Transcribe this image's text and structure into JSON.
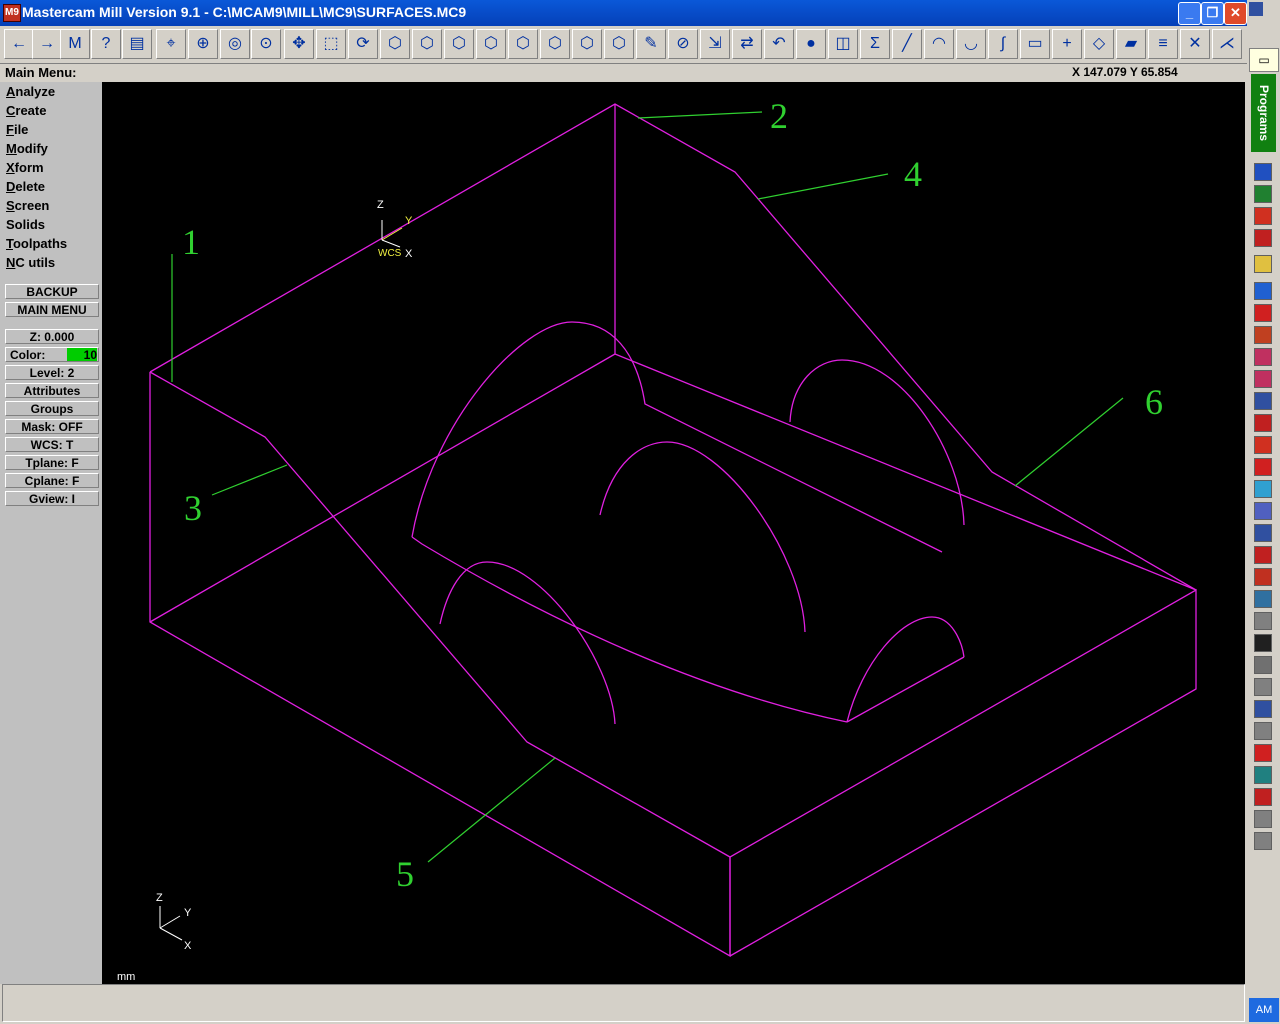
{
  "window": {
    "title": "Mastercam Mill Version 9.1 - C:\\MCAM9\\MILL\\MC9\\SURFACES.MC9",
    "app_icon": "M9"
  },
  "title_buttons": {
    "minimize": "_",
    "restore": "❐",
    "close": "✕"
  },
  "toolbar": [
    {
      "name": "back-icon",
      "glyph": "←"
    },
    {
      "name": "forward-icon",
      "glyph": "→"
    },
    {
      "name": "mcu-icon",
      "glyph": "M"
    },
    {
      "name": "help-icon",
      "glyph": "?"
    },
    {
      "name": "calculator-icon",
      "glyph": "▤"
    },
    {
      "name": "analyze-icon",
      "glyph": "⌖"
    },
    {
      "name": "zoom-window-icon",
      "glyph": "⊕"
    },
    {
      "name": "zoom-fit-icon",
      "glyph": "◎"
    },
    {
      "name": "zoom-unzoom-icon",
      "glyph": "⊙"
    },
    {
      "name": "pan-icon",
      "glyph": "✥"
    },
    {
      "name": "select-zoom-icon",
      "glyph": "⬚"
    },
    {
      "name": "rotate-icon",
      "glyph": "⟳"
    },
    {
      "name": "view-iso-icon",
      "glyph": "⬡"
    },
    {
      "name": "view-top-icon",
      "glyph": "⬡"
    },
    {
      "name": "view-front-icon",
      "glyph": "⬡"
    },
    {
      "name": "view-side-icon",
      "glyph": "⬡"
    },
    {
      "name": "cplane-top-icon",
      "glyph": "⬡"
    },
    {
      "name": "cplane-front-icon",
      "glyph": "⬡"
    },
    {
      "name": "cplane-side-icon",
      "glyph": "⬡"
    },
    {
      "name": "cplane-3d-icon",
      "glyph": "⬡"
    },
    {
      "name": "eraser-icon",
      "glyph": "✎"
    },
    {
      "name": "delete-icon",
      "glyph": "⊘"
    },
    {
      "name": "xform-translate-icon",
      "glyph": "⇲"
    },
    {
      "name": "xform-mirror-icon",
      "glyph": "⇄"
    },
    {
      "name": "undo-icon",
      "glyph": "↶"
    },
    {
      "name": "shade-sphere-icon",
      "glyph": "●"
    },
    {
      "name": "surface-icon",
      "glyph": "◫"
    },
    {
      "name": "sum-icon",
      "glyph": "Σ"
    },
    {
      "name": "line-icon",
      "glyph": "╱"
    },
    {
      "name": "arc-icon",
      "glyph": "◠"
    },
    {
      "name": "fillet-icon",
      "glyph": "◡"
    },
    {
      "name": "spline-icon",
      "glyph": "∫"
    },
    {
      "name": "rectangle-icon",
      "glyph": "▭"
    },
    {
      "name": "point-icon",
      "glyph": "+"
    },
    {
      "name": "plane-icon",
      "glyph": "◇"
    },
    {
      "name": "solid-box-icon",
      "glyph": "▰"
    },
    {
      "name": "layers-icon",
      "glyph": "≡"
    },
    {
      "name": "trim-icon",
      "glyph": "✕"
    },
    {
      "name": "trim-2-icon",
      "glyph": "⋌"
    }
  ],
  "main_menu_label": "Main Menu:",
  "coords": "X 147.079  Y 65.854",
  "menu": [
    {
      "key": "A",
      "rest": "nalyze"
    },
    {
      "key": "C",
      "rest": "reate"
    },
    {
      "key": "F",
      "rest": "ile"
    },
    {
      "key": "M",
      "rest": "odify"
    },
    {
      "key": "X",
      "rest": "form"
    },
    {
      "key": "D",
      "rest": "elete"
    },
    {
      "key": "S",
      "rest": "creen"
    },
    {
      "key": "",
      "rest": "Solids"
    },
    {
      "key": "T",
      "rest": "oolpaths"
    },
    {
      "key": "N",
      "rest": "C utils"
    }
  ],
  "buttons": {
    "backup": "BACKUP",
    "main_menu": "MAIN MENU"
  },
  "status": {
    "z": "Z:  0.000",
    "color_label": "Color:",
    "color_value": "10",
    "level": "Level:  2",
    "attributes": "Attributes",
    "groups": "Groups",
    "mask": "Mask:  OFF",
    "wcs": "WCS:   T",
    "tplane": "Tplane:  F",
    "cplane": "Cplane:  F",
    "gview": "Gview:   I"
  },
  "viewport": {
    "labels": [
      "1",
      "2",
      "3",
      "4",
      "5",
      "6"
    ],
    "wcs_axes": {
      "z": "Z",
      "y": "Y",
      "x": "X",
      "wcs": "WCS"
    },
    "corner_axes": {
      "z": "Z",
      "y": "Y",
      "x": "X"
    },
    "units": "mm",
    "colors": {
      "geometry": "#e020e0",
      "leader": "#30d030",
      "wcs": "#f0f040",
      "axes": "#ffffff"
    }
  },
  "rightbar": {
    "programs": "Programs",
    "clock": "AM"
  }
}
